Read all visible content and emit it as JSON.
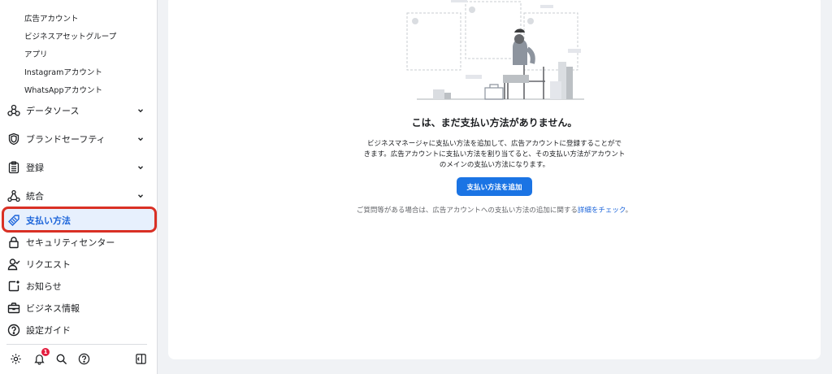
{
  "sidebar": {
    "sub_items": [
      {
        "label": "広告アカウント"
      },
      {
        "label": "ビジネスアセットグループ"
      },
      {
        "label": "アプリ"
      },
      {
        "label": "Instagramアカウント"
      },
      {
        "label": "WhatsAppアカウント"
      }
    ],
    "nav": {
      "data_sources": {
        "label": "データソース",
        "icon": "data-sources-icon"
      },
      "brand_safety": {
        "label": "ブランドセーフティ",
        "icon": "shield-icon"
      },
      "registration": {
        "label": "登録",
        "icon": "clipboard-icon"
      },
      "integrations": {
        "label": "統合",
        "icon": "integrations-icon"
      },
      "payment_methods": {
        "label": "支払い方法",
        "icon": "tag-icon"
      },
      "security_center": {
        "label": "セキュリティセンター",
        "icon": "lock-icon"
      },
      "requests": {
        "label": "リクエスト",
        "icon": "person-check-icon"
      },
      "notifications": {
        "label": "お知らせ",
        "icon": "notification-icon"
      },
      "business_info": {
        "label": "ビジネス情報",
        "icon": "briefcase-icon"
      },
      "setup_guide": {
        "label": "設定ガイド",
        "icon": "question-circle-icon"
      }
    },
    "bottom": {
      "notification_badge": "1"
    }
  },
  "main": {
    "title": "こは、まだ支払い方法がありません。",
    "description_line1": "ビジネスマネージャに支払い方法を追加して、広告アカウントに登録することがで",
    "description_line2": "きます。広告アカウントに支払い方法を割り当てると、その支払い方法がアカウント",
    "description_line3": "のメインの支払い方法になります。",
    "add_button": "支払い方法を追加",
    "help_prefix": "ご質問等がある場合は、広告アカウントへの支払い方法の追加に関する",
    "help_link": "詳細をチェック",
    "help_suffix": "。"
  },
  "colors": {
    "accent": "#1b74e4",
    "active_bg": "#e7f0fd",
    "highlight_border": "#d93025",
    "badge": "#e41e3f"
  }
}
